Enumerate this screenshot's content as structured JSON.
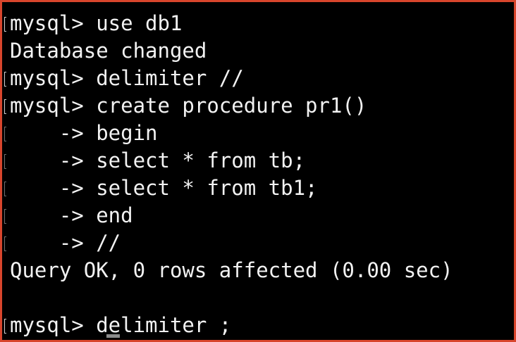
{
  "terminal": {
    "lines": [
      {
        "text": "mysql> use db1",
        "marker": "bright"
      },
      {
        "text": "Database changed",
        "marker": "none"
      },
      {
        "text": "mysql> delimiter //",
        "marker": "bright"
      },
      {
        "text": "mysql> create procedure pr1()",
        "marker": "bright"
      },
      {
        "text": "    -> begin",
        "marker": "dim"
      },
      {
        "text": "    -> select * from tb;",
        "marker": "dim"
      },
      {
        "text": "    -> select * from tb1;",
        "marker": "dim"
      },
      {
        "text": "    -> end",
        "marker": "dim"
      },
      {
        "text": "    -> //",
        "marker": "dim"
      },
      {
        "text": "Query OK, 0 rows affected (0.00 sec)",
        "marker": "none"
      },
      {
        "text": "",
        "marker": "none"
      },
      {
        "text": "mysql> delimiter ;",
        "marker": "bright"
      }
    ]
  },
  "colors": {
    "frame": "#d8452c",
    "background": "#000000",
    "foreground": "#f2f2f2",
    "cursor": "#8c8c8c"
  }
}
